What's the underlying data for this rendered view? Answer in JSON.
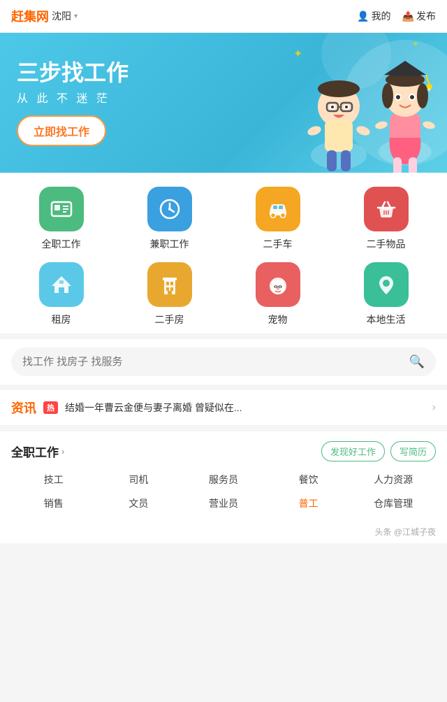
{
  "header": {
    "logo": "赶集网",
    "city": "沈阳",
    "city_chevron": "▾",
    "my_label": "我的",
    "publish_label": "发布"
  },
  "banner": {
    "title": "三步找工作",
    "subtitle": "从 此 不 迷 茫",
    "cta": "立即找工作"
  },
  "categories": [
    {
      "id": "fulltime",
      "label": "全职工作",
      "color": "icon-green",
      "icon": "id-card"
    },
    {
      "id": "parttime",
      "label": "兼职工作",
      "color": "icon-blue",
      "icon": "clock"
    },
    {
      "id": "used-car",
      "label": "二手车",
      "color": "icon-orange",
      "icon": "car"
    },
    {
      "id": "used-goods",
      "label": "二手物品",
      "color": "icon-red",
      "icon": "basket"
    },
    {
      "id": "rent",
      "label": "租房",
      "color": "icon-lightblue",
      "icon": "house"
    },
    {
      "id": "used-house",
      "label": "二手房",
      "color": "icon-amber",
      "icon": "building"
    },
    {
      "id": "pet",
      "label": "宠物",
      "color": "icon-teal",
      "icon": "pet"
    },
    {
      "id": "local",
      "label": "本地生活",
      "color": "icon-green2",
      "icon": "location"
    }
  ],
  "search": {
    "placeholder": "找工作 找房子 找服务"
  },
  "news": {
    "label": "资讯",
    "hot_badge": "热",
    "text": "结婚一年曹云金便与妻子离婚 曾疑似在...",
    "arrow": "›"
  },
  "jobs_section": {
    "title": "全职工作",
    "title_arrow": "›",
    "find_btn": "发现好工作",
    "resume_btn": "写简历",
    "tags_row1": [
      "技工",
      "司机",
      "服务员",
      "餐饮",
      "人力资源"
    ],
    "tags_row2": [
      "销售",
      "文员",
      "营业员",
      "普工",
      "仓库管理"
    ]
  },
  "watermark": "头条 @江城子夜"
}
